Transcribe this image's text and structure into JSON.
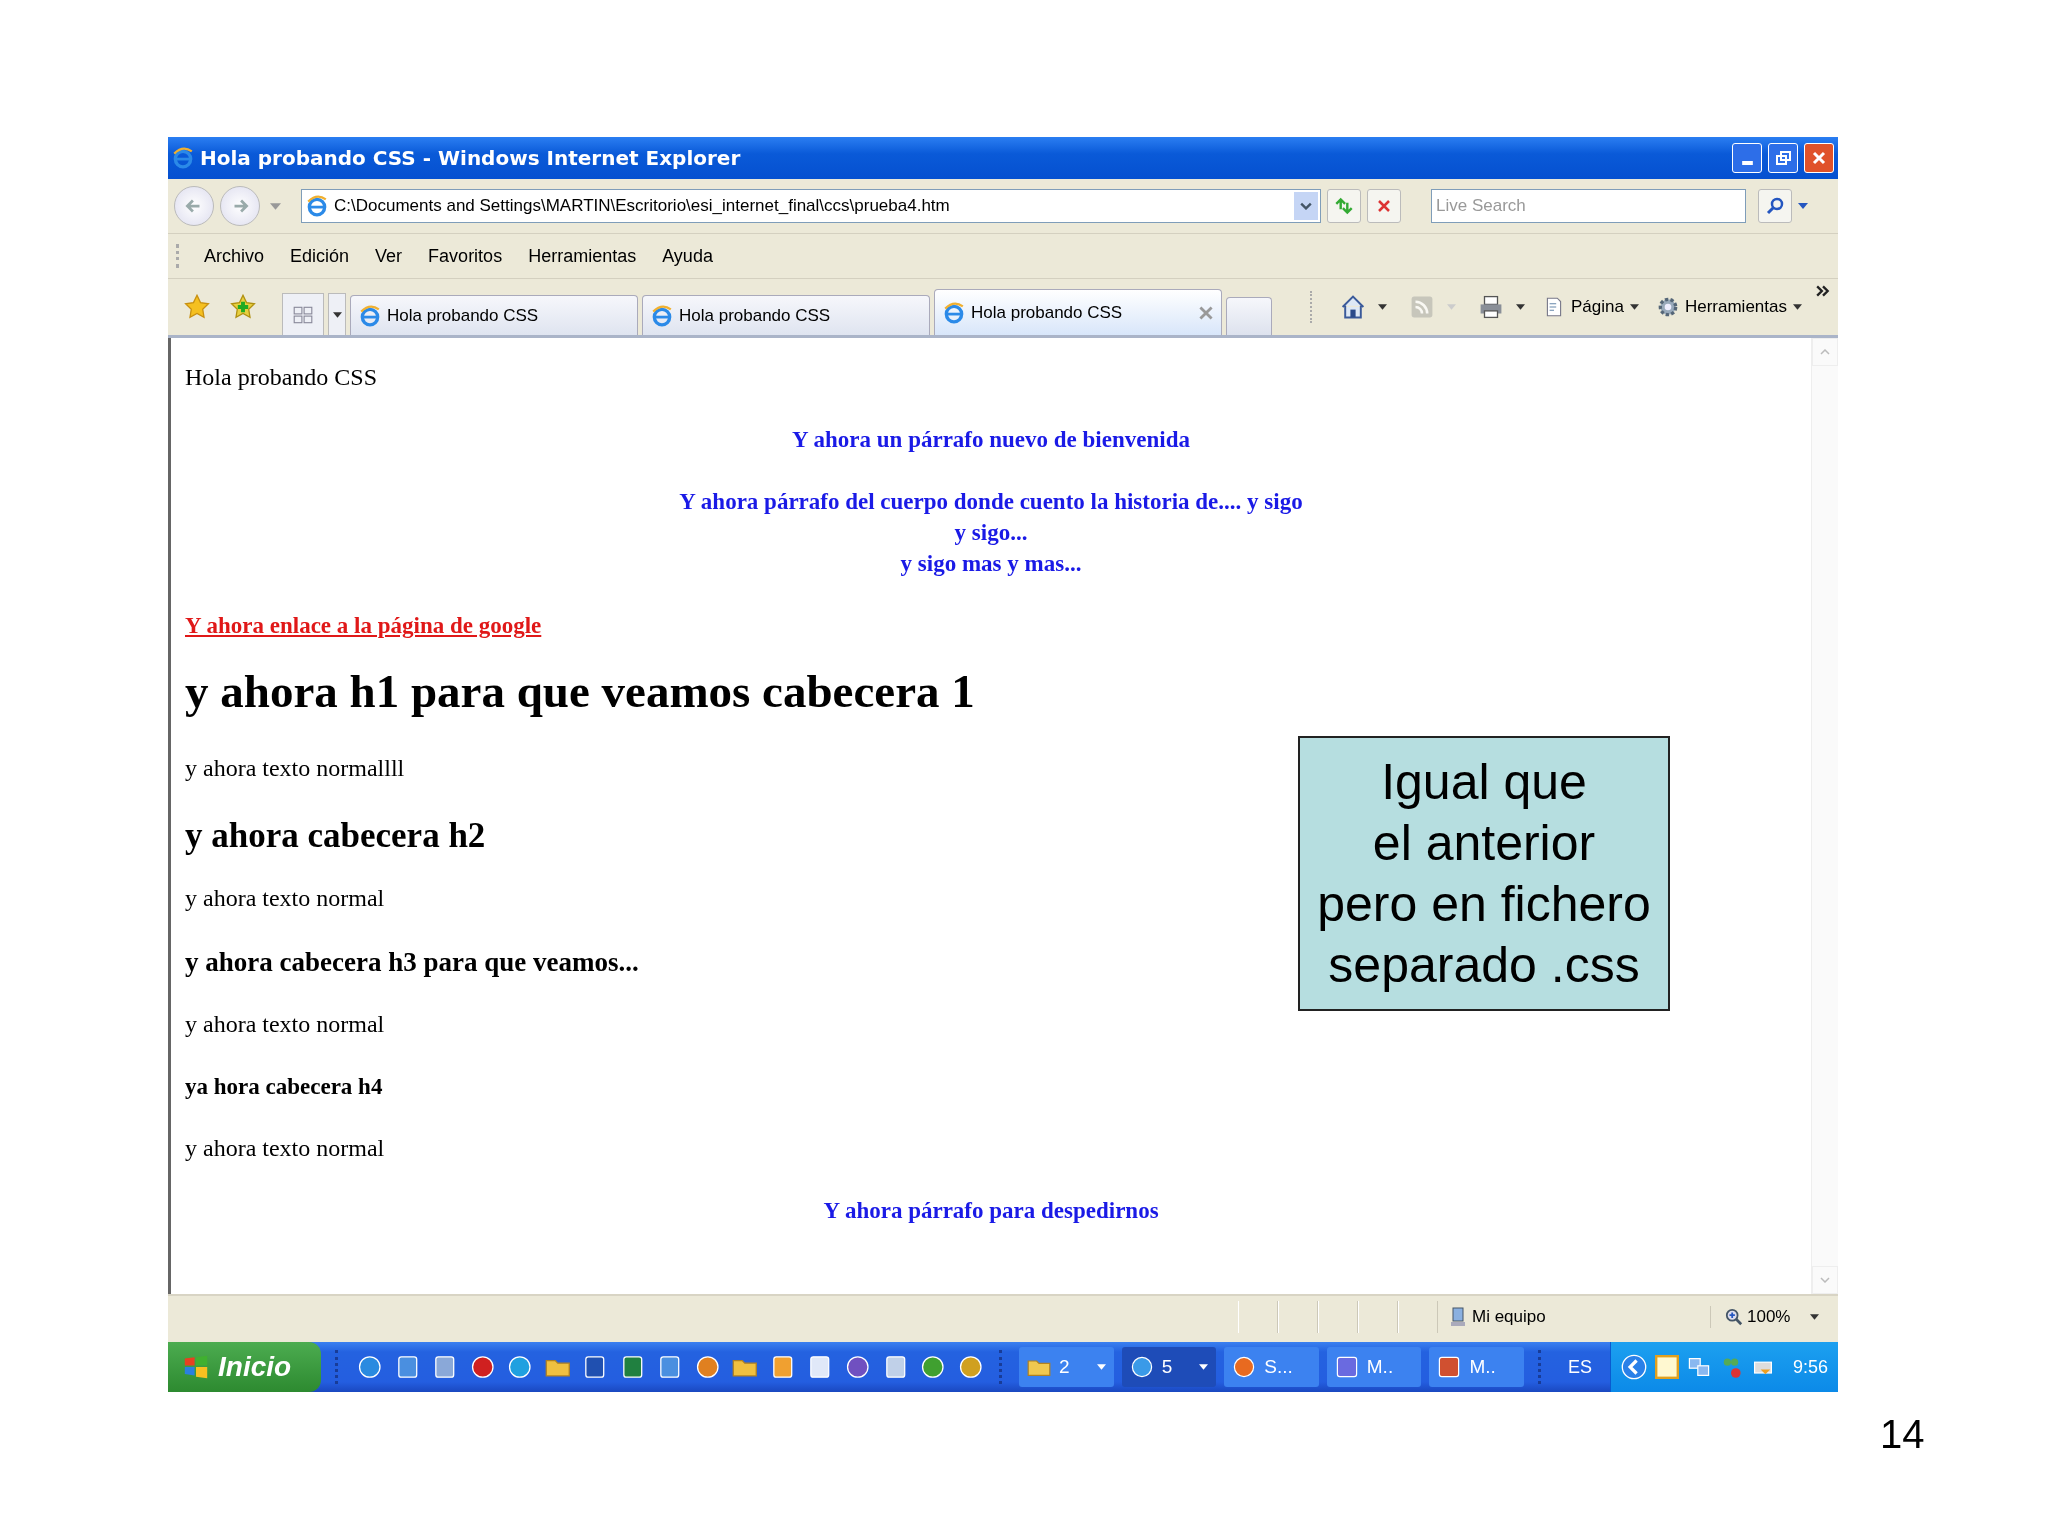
{
  "window": {
    "title": "Hola probando CSS - Windows Internet Explorer"
  },
  "address_bar": {
    "value": "C:\\Documents and Settings\\MARTIN\\Escritorio\\esi_internet_final\\ccs\\prueba4.htm"
  },
  "search": {
    "placeholder": "Live Search"
  },
  "menu": [
    "Archivo",
    "Edición",
    "Ver",
    "Favoritos",
    "Herramientas",
    "Ayuda"
  ],
  "tabs": [
    {
      "label": "Hola probando CSS",
      "selected": false
    },
    {
      "label": "Hola probando CSS",
      "selected": false
    },
    {
      "label": "Hola probando CSS",
      "selected": true
    }
  ],
  "command_bar": [
    {
      "kind": "page",
      "label": "Página"
    },
    {
      "kind": "tools",
      "label": "Herramientas"
    }
  ],
  "page": {
    "blocks": [
      {
        "kind": "text",
        "lines": [
          "Hola probando CSS"
        ]
      },
      {
        "kind": "centered",
        "lines": [
          "Y ahora un párrafo nuevo de bienvenida"
        ]
      },
      {
        "kind": "centered",
        "lines": [
          "Y ahora párrafo del cuerpo donde cuento la historia de.... y sigo",
          "y sigo...",
          "y sigo mas y mas..."
        ]
      },
      {
        "kind": "link",
        "lines": [
          "Y ahora enlace a la página de google"
        ]
      },
      {
        "kind": "h1",
        "lines": [
          "y ahora h1 para que veamos cabecera 1"
        ]
      },
      {
        "kind": "text",
        "lines": [
          "y ahora texto normallll"
        ]
      },
      {
        "kind": "h2",
        "lines": [
          "y ahora cabecera h2"
        ]
      },
      {
        "kind": "text",
        "lines": [
          "y ahora texto normal"
        ]
      },
      {
        "kind": "h3",
        "lines": [
          "y ahora cabecera h3 para que veamos..."
        ]
      },
      {
        "kind": "text",
        "lines": [
          "y ahora texto normal"
        ]
      },
      {
        "kind": "h4",
        "lines": [
          "ya hora cabecera h4"
        ]
      },
      {
        "kind": "text",
        "lines": [
          "y ahora texto normal"
        ]
      },
      {
        "kind": "centered",
        "lines": [
          "Y ahora párrafo para despedirnos"
        ]
      }
    ]
  },
  "callout": {
    "lines": [
      "Igual que",
      "el anterior",
      "pero en fichero",
      "separado .css"
    ]
  },
  "status_bar": {
    "zone": "Mi equipo",
    "zoom": "100%"
  },
  "taskbar": {
    "start": "Inicio",
    "buttons": [
      {
        "kind": "folder",
        "label": "2",
        "selected": false
      },
      {
        "kind": "browser",
        "label": "5",
        "selected": true
      },
      {
        "kind": "globe",
        "label": "S...",
        "selected": false
      },
      {
        "kind": "window",
        "label": "M..",
        "selected": false
      },
      {
        "kind": "slides",
        "label": "M..",
        "selected": false
      }
    ],
    "language": "ES",
    "clock": "9:56"
  },
  "slide_number": "14"
}
